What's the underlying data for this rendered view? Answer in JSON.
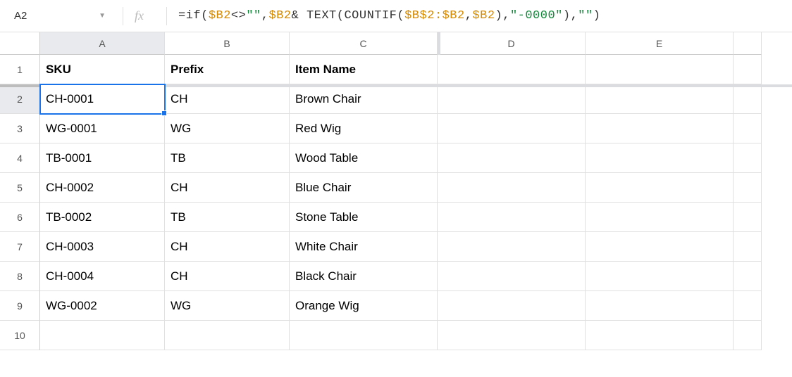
{
  "nameBox": "A2",
  "formula": {
    "tokens": [
      {
        "t": "=if",
        "c": "op"
      },
      {
        "t": "(",
        "c": "op"
      },
      {
        "t": "$B2",
        "c": "ref"
      },
      {
        "t": "<>",
        "c": "op"
      },
      {
        "t": "\"\"",
        "c": "str"
      },
      {
        "t": ",",
        "c": "op"
      },
      {
        "t": "$B2",
        "c": "ref"
      },
      {
        "t": " & TEXT",
        "c": "op"
      },
      {
        "t": "(",
        "c": "op"
      },
      {
        "t": "COUNTIF",
        "c": "op"
      },
      {
        "t": "(",
        "c": "op"
      },
      {
        "t": "$B$2:$B2",
        "c": "ref"
      },
      {
        "t": ",",
        "c": "op"
      },
      {
        "t": "$B2",
        "c": "ref"
      },
      {
        "t": ")",
        "c": "op"
      },
      {
        "t": ",",
        "c": "op"
      },
      {
        "t": "\"-0000\"",
        "c": "str"
      },
      {
        "t": ")",
        "c": "op"
      },
      {
        "t": ",",
        "c": "op"
      },
      {
        "t": "\"\"",
        "c": "str"
      },
      {
        "t": ")",
        "c": "op"
      }
    ]
  },
  "columns": [
    "A",
    "B",
    "C",
    "D",
    "E"
  ],
  "rowNumbers": [
    "1",
    "2",
    "3",
    "4",
    "5",
    "6",
    "7",
    "8",
    "9",
    "10"
  ],
  "headers": {
    "A": "SKU",
    "B": "Prefix",
    "C": "Item Name"
  },
  "rows": [
    {
      "A": "CH-0001",
      "B": "CH",
      "C": "Brown Chair"
    },
    {
      "A": "WG-0001",
      "B": "WG",
      "C": "Red Wig"
    },
    {
      "A": "TB-0001",
      "B": "TB",
      "C": "Wood Table"
    },
    {
      "A": "CH-0002",
      "B": "CH",
      "C": "Blue Chair"
    },
    {
      "A": "TB-0002",
      "B": "TB",
      "C": "Stone Table"
    },
    {
      "A": "CH-0003",
      "B": "CH",
      "C": "White Chair"
    },
    {
      "A": "CH-0004",
      "B": "CH",
      "C": "Black Chair"
    },
    {
      "A": "WG-0002",
      "B": "WG",
      "C": "Orange Wig"
    }
  ],
  "selectedCell": {
    "row": 2,
    "col": "A"
  }
}
